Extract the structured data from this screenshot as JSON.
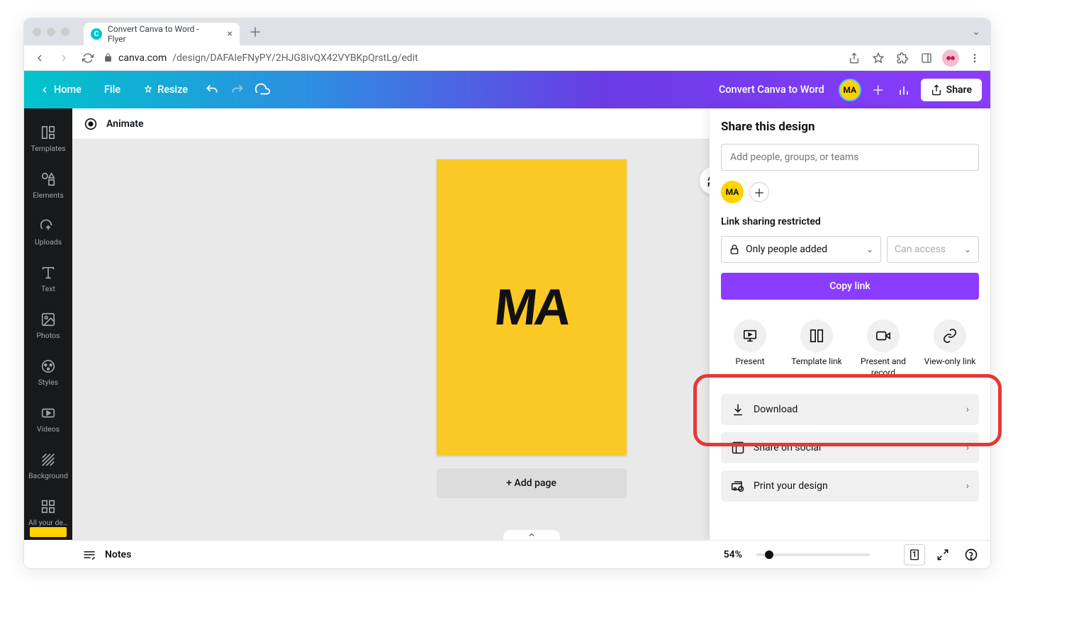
{
  "browser": {
    "tab_title": "Convert Canva to Word - Flyer",
    "url_host": "canva.com",
    "url_path": "/design/DAFAIeFNyPY/2HJG8IvQX42VYBKpQrstLg/edit"
  },
  "header": {
    "home": "Home",
    "file": "File",
    "resize": "Resize",
    "doc_title": "Convert Canva to Word",
    "avatar": "MA",
    "share": "Share"
  },
  "sidebar": {
    "items": [
      {
        "label": "Templates"
      },
      {
        "label": "Elements"
      },
      {
        "label": "Uploads"
      },
      {
        "label": "Text"
      },
      {
        "label": "Photos"
      },
      {
        "label": "Styles"
      },
      {
        "label": "Videos"
      },
      {
        "label": "Background"
      },
      {
        "label": "All your de…"
      }
    ]
  },
  "context": {
    "animate": "Animate"
  },
  "canvas": {
    "text": "MA",
    "add_page": "+ Add page"
  },
  "bottom": {
    "notes": "Notes",
    "zoom": "54%",
    "page_indicator": "1"
  },
  "share_panel": {
    "title": "Share this design",
    "input_placeholder": "Add people, groups, or teams",
    "avatar": "MA",
    "link_label": "Link sharing restricted",
    "access_select": "Only people added",
    "perm_select": "Can access",
    "copy_link": "Copy link",
    "options": [
      {
        "label": "Present"
      },
      {
        "label": "Template link"
      },
      {
        "label": "Present and record"
      },
      {
        "label": "View-only link"
      }
    ],
    "actions": [
      {
        "label": "Download"
      },
      {
        "label": "Share on social"
      },
      {
        "label": "Print your design"
      }
    ]
  }
}
